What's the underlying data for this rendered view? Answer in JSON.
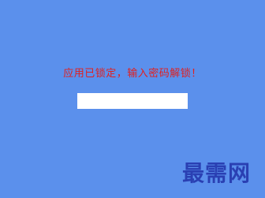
{
  "lock_screen": {
    "message": "应用已锁定，输入密码解锁！",
    "password_value": "",
    "password_placeholder": ""
  },
  "watermark": {
    "text": "最需网"
  },
  "colors": {
    "background": "#5b90ec",
    "message": "#e02020",
    "input_background": "#ffffff",
    "watermark": "#2233aa"
  }
}
